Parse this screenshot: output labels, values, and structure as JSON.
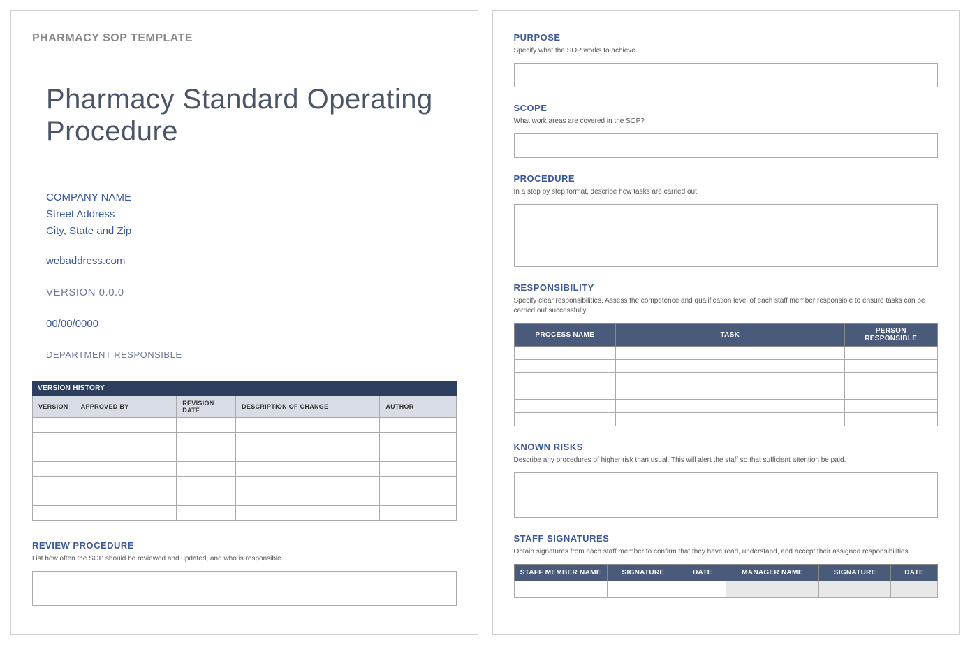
{
  "page1": {
    "header": "PHARMACY SOP TEMPLATE",
    "title": "Pharmacy Standard Operating Procedure",
    "company": {
      "name": "COMPANY NAME",
      "street": "Street Address",
      "city": "City, State and Zip"
    },
    "web": "webaddress.com",
    "version": "VERSION 0.0.0",
    "date": "00/00/0000",
    "department": "DEPARTMENT RESPONSIBLE",
    "versionHistory": {
      "title": "VERSION HISTORY",
      "columns": [
        "VERSION",
        "APPROVED BY",
        "REVISION DATE",
        "DESCRIPTION OF CHANGE",
        "AUTHOR"
      ],
      "rows": 7
    },
    "review": {
      "heading": "REVIEW PROCEDURE",
      "desc": "List how often the SOP should be reviewed and updated, and who is responsible."
    }
  },
  "page2": {
    "purpose": {
      "heading": "PURPOSE",
      "desc": "Specify what the SOP works to achieve."
    },
    "scope": {
      "heading": "SCOPE",
      "desc": "What work areas are covered in the SOP?"
    },
    "procedure": {
      "heading": "PROCEDURE",
      "desc": "In a step by step format, describe how tasks are carried out."
    },
    "responsibility": {
      "heading": "RESPONSIBILITY",
      "desc": "Specify clear responsibilities.  Assess the competence and qualification level of each staff member responsible to ensure tasks can be carried out successfully.",
      "columns": [
        "PROCESS NAME",
        "TASK",
        "PERSON RESPONSIBLE"
      ],
      "rows": 6
    },
    "risks": {
      "heading": "KNOWN RISKS",
      "desc": "Describe any procedures of higher risk than usual.  This will alert the staff so that sufficient attention be paid."
    },
    "signatures": {
      "heading": "STAFF SIGNATURES",
      "desc": "Obtain signatures from each staff member to confirm that they have read, understand, and accept their assigned responsibilities.",
      "columns": [
        "STAFF MEMBER NAME",
        "SIGNATURE",
        "DATE",
        "MANAGER NAME",
        "SIGNATURE",
        "DATE"
      ]
    }
  }
}
